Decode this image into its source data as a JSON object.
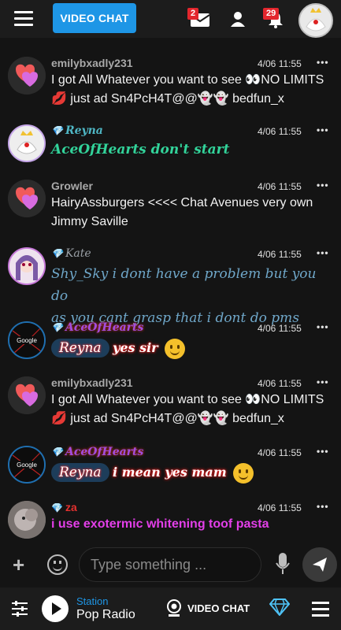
{
  "header": {
    "video_chat_label": "VIDEO CHAT",
    "mail_badge": "2",
    "notif_badge": "29"
  },
  "messages": [
    {
      "user": "emilybxadly231",
      "time": "4/06 11:55",
      "dots": "•••",
      "line1": "I got All Whatever you want to see 👀NO LIMITS",
      "line2": "💋 just ad Sn4PcH4T@@👻👻 bedfun_x"
    },
    {
      "user": "Reyna",
      "time": "4/06 11:55",
      "dots": "•••",
      "text": "AceOfHearts don't start"
    },
    {
      "user": "Growler",
      "time": "4/06 11:55",
      "dots": "•••",
      "line1": "HairyAssburgers <<<< Chat Avenues very own",
      "line2": "Jimmy Saville"
    },
    {
      "user": "Kate",
      "time": "4/06 11:55",
      "dots": "•••",
      "line1": "Shy_Sky i dont have a problem but you do",
      "line2": "as you cant grasp that i dont do pms"
    },
    {
      "user": "AceOfHearts",
      "time": "4/06 11:55",
      "dots": "•••",
      "mention": "Reyna",
      "text": "yes sir"
    },
    {
      "user": "emilybxadly231",
      "time": "4/06 11:55",
      "dots": "•••",
      "line1": "I got All Whatever you want to see 👀NO LIMITS",
      "line2": "💋 just ad Sn4PcH4T@@👻👻 bedfun_x"
    },
    {
      "user": "AceOfHearts",
      "time": "4/06 11:55",
      "dots": "•••",
      "mention": "Reyna",
      "text": "i mean yes mam"
    },
    {
      "user": "za",
      "time": "4/06 11:55",
      "dots": "•••",
      "text": "i use exotermic whitening toof pasta"
    }
  ],
  "avatar_labels": {
    "google": "Google"
  },
  "composer": {
    "placeholder": "Type something ..."
  },
  "player": {
    "station_label": "Station",
    "station_name": "Pop Radio",
    "video_chat_label": "VIDEO CHAT"
  },
  "colors": {
    "accent": "#1e96e6",
    "badge": "#e3262d",
    "reyna_text": "#32d39a",
    "kate_text": "#6fa7c9",
    "za_text": "#e33fe9",
    "gem": "#6fd3f7"
  },
  "icons": [
    "menu-icon",
    "mail-icon",
    "user-icon",
    "bell-icon",
    "plus-icon",
    "emoji-icon",
    "mic-icon",
    "send-icon",
    "sliders-icon",
    "play-icon",
    "camera-icon",
    "diamond-icon"
  ]
}
